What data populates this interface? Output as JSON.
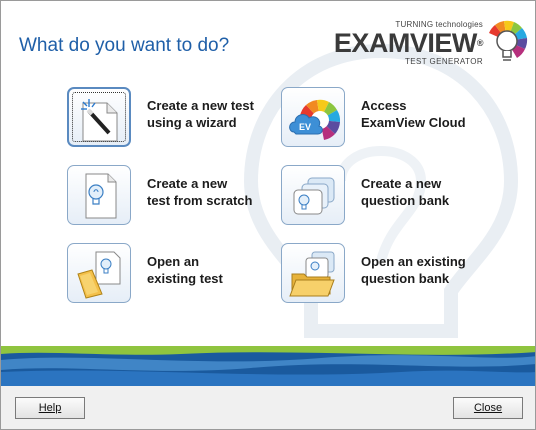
{
  "window": {
    "heading": "What do you want to do?"
  },
  "logo": {
    "company": "TURNING technologies",
    "product": "EXAMVIEW",
    "registered": "®",
    "tagline": "TEST GENERATOR"
  },
  "options": [
    {
      "line1": "Create a new test",
      "line2": "using a wizard",
      "icon": "wizard-wand-icon"
    },
    {
      "line1": "Access",
      "line2": "ExamView Cloud",
      "icon": "examview-cloud-icon"
    },
    {
      "line1": "Create a new",
      "line2": "test from scratch",
      "icon": "new-test-document-icon"
    },
    {
      "line1": "Create a new",
      "line2": "question bank",
      "icon": "new-question-bank-icon"
    },
    {
      "line1": "Open an",
      "line2": "existing test",
      "icon": "open-test-folder-icon"
    },
    {
      "line1": "Open an existing",
      "line2": "question bank",
      "icon": "open-question-bank-folder-icon"
    }
  ],
  "footer": {
    "help_label": "Help",
    "close_label": "Close"
  },
  "colors": {
    "heading": "#1f5fa8",
    "wave_dark": "#1a5a9e",
    "wave_green": "#8fc43f"
  }
}
